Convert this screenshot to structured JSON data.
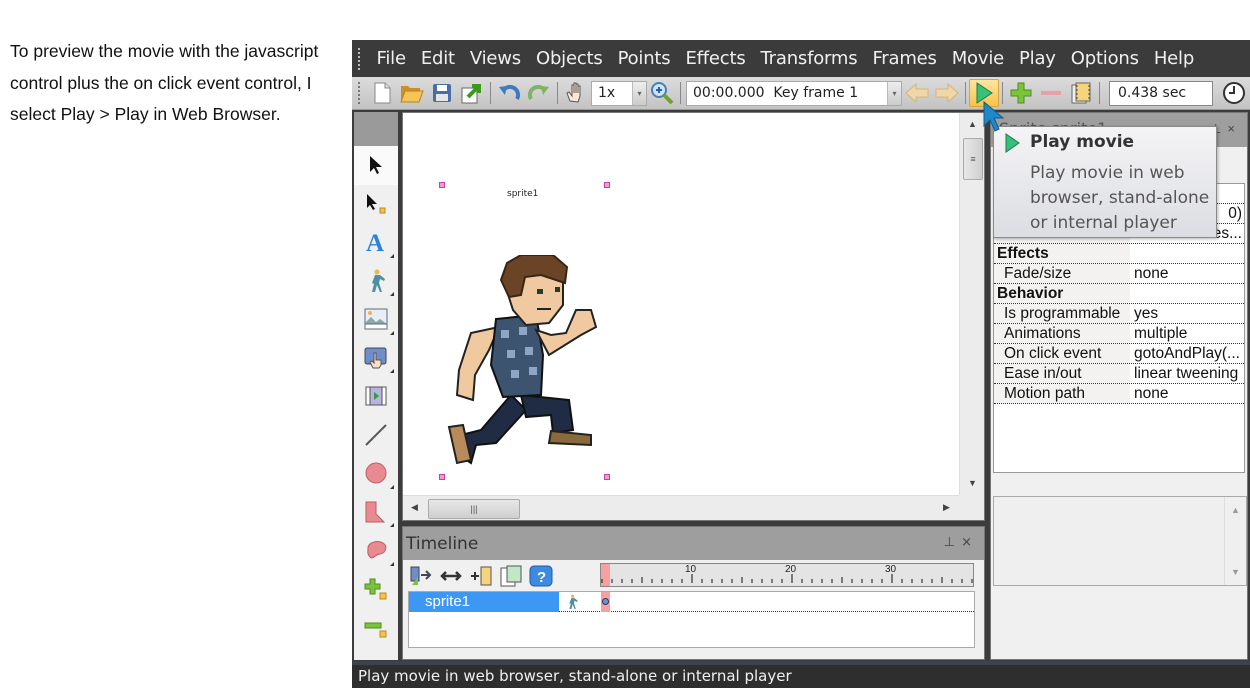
{
  "caption": "To preview the movie with the javascript control plus the on click event control, I select Play > Play in Web Browser.",
  "menubar": {
    "items": [
      "File",
      "Edit",
      "Views",
      "Objects",
      "Points",
      "Effects",
      "Transforms",
      "Frames",
      "Movie",
      "Play",
      "Options",
      "Help"
    ]
  },
  "toolbar": {
    "zoom_value": "1x",
    "frame_combo_value": "00:00.000  Key frame 1",
    "duration_value": "0.438 sec",
    "buttons": [
      "new-icon",
      "open-icon",
      "save-icon",
      "export-icon",
      "undo-icon",
      "redo-icon",
      "hand-icon",
      "zoom-icon",
      "prev-frame-icon",
      "next-frame-icon",
      "play-icon",
      "add-frame-icon",
      "remove-frame-icon",
      "frame-properties-icon",
      "clock-icon"
    ]
  },
  "toolbox": {
    "tools": [
      "select-arrow",
      "point-select",
      "text",
      "sprite",
      "image",
      "button",
      "video",
      "line",
      "circle",
      "shape",
      "freeform",
      "add-point",
      "remove-point"
    ]
  },
  "canvas": {
    "sprite_label": "sprite1"
  },
  "timeline": {
    "title": "Timeline",
    "ruler_labels": [
      "10",
      "20",
      "30"
    ],
    "rows": [
      {
        "name": "sprite1",
        "selected": true
      }
    ]
  },
  "properties": {
    "title": "Sprite sprite1",
    "partial_values": [
      "0)",
      "es..."
    ],
    "groups": [
      {
        "name": "Effects",
        "rows": [
          {
            "key": "Fade/size",
            "value": "none"
          }
        ]
      },
      {
        "name": "Behavior",
        "rows": [
          {
            "key": "Is programmable",
            "value": "yes"
          },
          {
            "key": "Animations",
            "value": "multiple"
          },
          {
            "key": "On click event",
            "value": "gotoAndPlay(..."
          },
          {
            "key": "Ease in/out",
            "value": "linear tweening"
          },
          {
            "key": "Motion path",
            "value": "none"
          }
        ]
      }
    ]
  },
  "tooltip": {
    "title": "Play movie",
    "body": "Play movie in web browser, stand-alone or internal player"
  },
  "statusbar": {
    "text": "Play movie in web browser, stand-alone or internal player"
  },
  "colors": {
    "menubar_bg": "#3b3b3b",
    "selection_blue": "#3d98f5",
    "keyframe_pink": "#f7a0a0",
    "play_highlight": "#f7c247"
  }
}
